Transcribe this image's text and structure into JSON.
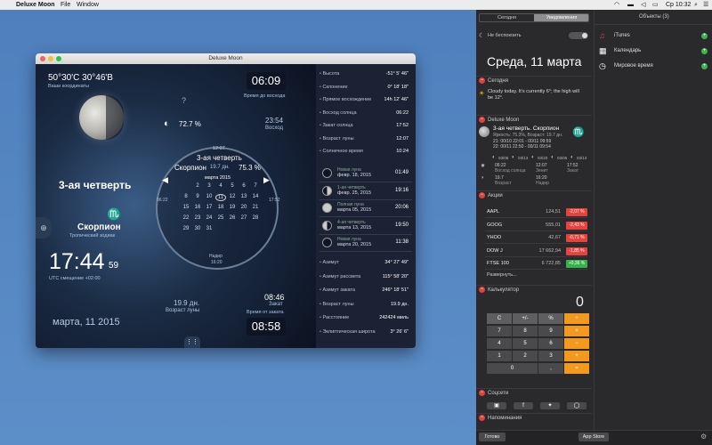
{
  "menubar": {
    "app": "Deluxe Moon",
    "file": "File",
    "window": "Window",
    "time": "Ср 10:32"
  },
  "window": {
    "title": "Deluxe Moon"
  },
  "main": {
    "coords": "50°30'C 30°46'В",
    "coords_label": "Ваши координаты",
    "sunrise_time": "06:09",
    "sunrise_label": "Время до восхода",
    "illumination": "72.7 %",
    "rise_time": "23:54",
    "rise_label": "Восход",
    "phase": "3-ая четверть",
    "sign": "Скорпион",
    "zodiac_label": "Тропический зодиак",
    "clock": "17:44",
    "seconds": "59",
    "utc": "UTC смещение +02:00",
    "age": "19.9 дн.",
    "age_label": "Возраст луны",
    "set_time": "08:46",
    "set_label": "Закат",
    "to_set_time": "08:58",
    "to_set_label": "Время от заката",
    "date": "марта, 11 2015",
    "dial": {
      "top": "12:07",
      "phase": "3-ая четверть",
      "sign": "Скорпион",
      "age": "19.7 дн.",
      "pct": "75.3 %",
      "month": "марта 2015",
      "left": "06:22",
      "right": "17:52",
      "nadir": "Надир",
      "nadir_time": "16:20"
    },
    "calendar": [
      "2",
      "3",
      "4",
      "5",
      "6",
      "7",
      "8",
      "9",
      "10",
      "11",
      "12",
      "13",
      "14",
      "15",
      "16",
      "17",
      "18",
      "19",
      "20",
      "21",
      "22",
      "23",
      "24",
      "25",
      "26",
      "27",
      "28",
      "29",
      "30",
      "31"
    ]
  },
  "side": {
    "rows1": [
      {
        "k": "Высота",
        "v": "-51° 5' 46\""
      },
      {
        "k": "Склонение",
        "v": "0° 18' 18\""
      },
      {
        "k": "Прямое восхождение",
        "v": "14h 12' 46\""
      },
      {
        "k": "Восход солнца",
        "v": "06:22"
      },
      {
        "k": "Закат солнца",
        "v": "17:52"
      },
      {
        "k": "Возраст луны",
        "v": "12:07"
      },
      {
        "k": "Солнечное время",
        "v": "10:24"
      }
    ],
    "moons": [
      {
        "k": "Новая луна",
        "d": "февр. 18, 2015",
        "v": "01:49"
      },
      {
        "k": "1-ая четверть",
        "d": "февр. 25, 2015",
        "v": "19:16"
      },
      {
        "k": "Полная луна",
        "d": "марта 05, 2015",
        "v": "20:06"
      },
      {
        "k": "4-ая четверть",
        "d": "марта 13, 2015",
        "v": "19:50"
      },
      {
        "k": "Новая луна",
        "d": "марта 20, 2015",
        "v": "11:38"
      }
    ],
    "rows2": [
      {
        "k": "Азимут",
        "v": "34° 27' 49\""
      },
      {
        "k": "Азимут рассвета",
        "v": "115° 58' 20\""
      },
      {
        "k": "Азимут заката",
        "v": "246° 18' 51\""
      },
      {
        "k": "Возраст луны",
        "v": "19.9 дн."
      },
      {
        "k": "Расстояние",
        "v": "242424 миль"
      },
      {
        "k": "Эклиптическая широта",
        "v": "3° 26' 6\""
      }
    ]
  },
  "nc": {
    "tab_today": "Сегодня",
    "tab_notifications": "Уведомления",
    "dnd": "Не беспокоить",
    "date": "Среда, 11 марта",
    "today_head": "Сегодня",
    "weather": "Cloudy today. It's currently 6°; the high will be 12°.",
    "dm_head": "Deluxe Moon",
    "dm_phase": "3-ая четверть. Скорпион",
    "dm_sub": "Яркость: 75.3%, Возраст: 19.7 дн.",
    "dm_l1": "21: 00/10 22:01 - 00/11 09:59",
    "dm_l2": "22: 00/11 22:50 - 00/11 09:54",
    "dm_dates": [
      "03/05",
      "03/13",
      "03/20",
      "03/05",
      "03/13"
    ],
    "dm_rise": "06:22",
    "dm_rise_l": "Восход солнца",
    "dm_top": "12:07",
    "dm_top_l": "Зенит",
    "dm_set": "17:52",
    "dm_set_l": "Закат",
    "dm_nadir": "16:20",
    "dm_nadir_l": "Надир",
    "dm_age": "19.7",
    "dm_age_l": "Возраст",
    "stocks_head": "Акции",
    "stocks": [
      {
        "s": "AAPL",
        "p": "124,51",
        "c": "-2,07 %",
        "up": false
      },
      {
        "s": "GOOG",
        "p": "555,01",
        "c": "-2,43 %",
        "up": false
      },
      {
        "s": "YHOO",
        "p": "42,67",
        "c": "-0,71 %",
        "up": false
      },
      {
        "s": "DOW J",
        "p": "17 662,94",
        "c": "-1,85 %",
        "up": false
      },
      {
        "s": "FTSE 100",
        "p": "6 722,85",
        "c": "+0,36 %",
        "up": true
      }
    ],
    "expand": "Развернуть...",
    "calc_head": "Калькулятор",
    "calc_display": "0",
    "keys": [
      "C",
      "+/-",
      "%",
      "÷",
      "7",
      "8",
      "9",
      "×",
      "4",
      "5",
      "6",
      "−",
      "1",
      "2",
      "3",
      "+",
      "0",
      "",
      ",",
      "="
    ],
    "social_head": "Соцсети",
    "reminders_head": "Напоминания",
    "done": "Готово",
    "appstore": "App Store",
    "objects_head": "Объекты (3)",
    "objects": [
      "iTunes",
      "Календарь",
      "Мировое время"
    ]
  }
}
